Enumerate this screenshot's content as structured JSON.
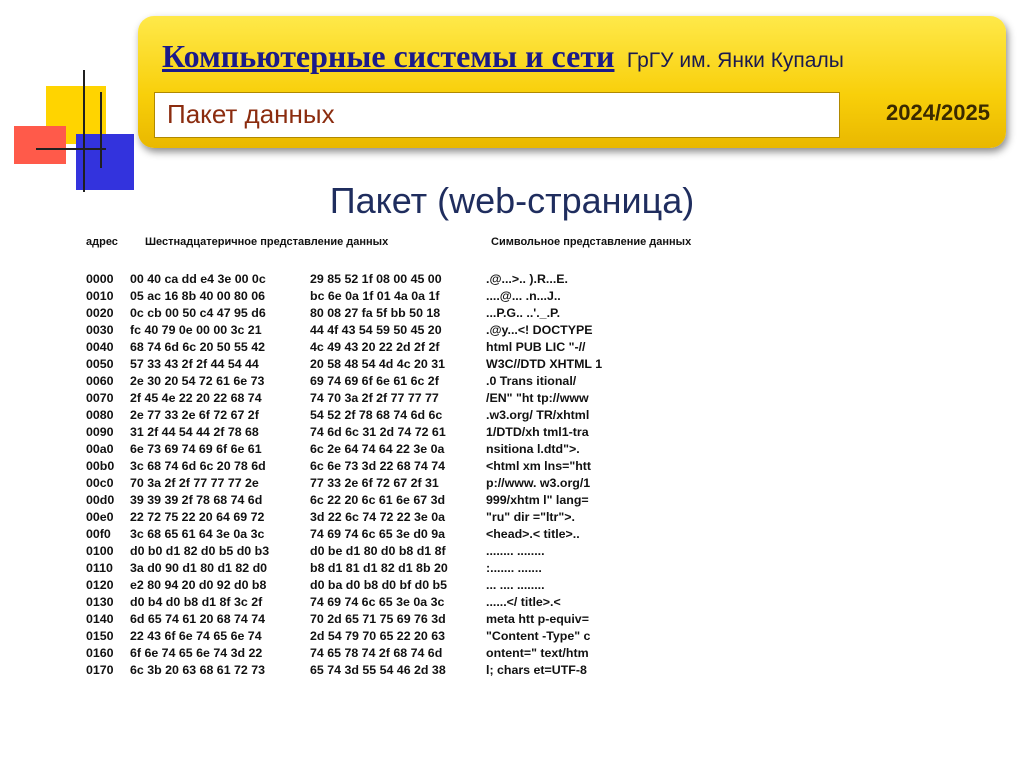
{
  "header": {
    "course": "Компьютерные системы и сети",
    "university": "ГрГУ им. Янки Купалы",
    "subtitle": "Пакет данных",
    "year": "2024/2025"
  },
  "slide_title": "Пакет (web-страница)",
  "columns": {
    "address": "адрес",
    "hex": "Шестнадцатеричное представление данных",
    "chars": "Символьное представление данных"
  },
  "rows": [
    {
      "addr": "0000",
      "hex1": "00 40 ca dd e4 3e 00 0c",
      "hex2": "29 85 52 1f 08 00 45 00",
      "chars": ".@...>.. ).R...E."
    },
    {
      "addr": "0010",
      "hex1": "05 ac 16 8b 40 00 80 06",
      "hex2": "bc 6e 0a 1f 01 4a 0a 1f",
      "chars": "....@... .n...J.."
    },
    {
      "addr": "0020",
      "hex1": "0c cb 00 50 c4 47 95 d6",
      "hex2": "80 08 27 fa 5f bb 50 18",
      "chars": "...P.G.. ..'._.P."
    },
    {
      "addr": "0030",
      "hex1": "fc 40 79 0e 00 00 3c 21",
      "hex2": "44 4f 43 54 59 50 45 20",
      "chars": ".@y...<! DOCTYPE"
    },
    {
      "addr": "0040",
      "hex1": "68 74 6d 6c 20 50 55 42",
      "hex2": "4c 49 43 20 22 2d 2f 2f",
      "chars": "html PUB LIC \"-//"
    },
    {
      "addr": "0050",
      "hex1": "57 33 43 2f 2f 44 54 44",
      "hex2": "20 58 48 54 4d 4c 20 31",
      "chars": "W3C//DTD  XHTML 1"
    },
    {
      "addr": "0060",
      "hex1": "2e 30 20 54 72 61 6e 73",
      "hex2": "69 74 69 6f 6e 61 6c 2f",
      "chars": ".0 Trans itional/"
    },
    {
      "addr": "0070",
      "hex1": "2f 45 4e 22 20 22 68 74",
      "hex2": "74 70 3a 2f 2f 77 77 77",
      "chars": "/EN\" \"ht tp://www"
    },
    {
      "addr": "0080",
      "hex1": "2e 77 33 2e 6f 72 67 2f",
      "hex2": "54 52 2f 78 68 74 6d 6c",
      "chars": ".w3.org/ TR/xhtml"
    },
    {
      "addr": "0090",
      "hex1": "31 2f 44 54 44 2f 78 68",
      "hex2": "74 6d 6c 31 2d 74 72 61",
      "chars": "1/DTD/xh tml1-tra"
    },
    {
      "addr": "00a0",
      "hex1": "6e 73 69 74 69 6f 6e 61",
      "hex2": "6c 2e 64 74 64 22 3e 0a",
      "chars": "nsitiona l.dtd\">."
    },
    {
      "addr": "00b0",
      "hex1": "3c 68 74 6d 6c 20 78 6d",
      "hex2": "6c 6e 73 3d 22 68 74 74",
      "chars": "<html xm lns=\"htt"
    },
    {
      "addr": "00c0",
      "hex1": "70 3a 2f 2f 77 77 77 2e",
      "hex2": "77 33 2e 6f 72 67 2f 31",
      "chars": "p://www. w3.org/1"
    },
    {
      "addr": "00d0",
      "hex1": "39 39 39 2f 78 68 74 6d",
      "hex2": "6c 22 20 6c 61 6e 67 3d",
      "chars": "999/xhtm l\" lang="
    },
    {
      "addr": "00e0",
      "hex1": "22 72 75 22 20 64 69 72",
      "hex2": "3d 22 6c 74 72 22 3e 0a",
      "chars": "\"ru\" dir =\"ltr\">."
    },
    {
      "addr": "00f0",
      "hex1": "3c 68 65 61 64 3e 0a 3c",
      "hex2": "74 69 74 6c 65 3e d0 9a",
      "chars": "<head>.< title>.."
    },
    {
      "addr": "0100",
      "hex1": "d0 b0 d1 82 d0 b5 d0 b3",
      "hex2": "d0 be d1 80 d0 b8 d1 8f",
      "chars": "........ ........"
    },
    {
      "addr": "0110",
      "hex1": "3a d0 90 d1 80 d1 82 d0",
      "hex2": "b8 d1 81 d1 82 d1 8b 20",
      "chars": ":....... ......."
    },
    {
      "addr": "0120",
      "hex1": "e2 80 94 20 d0 92 d0 b8",
      "hex2": "d0 ba d0 b8 d0 bf d0 b5",
      "chars": "... .... ........"
    },
    {
      "addr": "0130",
      "hex1": "d0 b4 d0 b8 d1 8f 3c 2f",
      "hex2": "74 69 74 6c 65 3e 0a 3c",
      "chars": "......</ title>.<"
    },
    {
      "addr": "0140",
      "hex1": "6d 65 74 61 20 68 74 74",
      "hex2": "70 2d 65 71 75 69 76 3d",
      "chars": "meta htt p-equiv="
    },
    {
      "addr": "0150",
      "hex1": "22 43 6f 6e 74 65 6e 74",
      "hex2": "2d 54 79 70 65 22 20 63",
      "chars": "\"Content -Type\" c"
    },
    {
      "addr": "0160",
      "hex1": "6f 6e 74 65 6e 74 3d 22",
      "hex2": "74 65 78 74 2f 68 74 6d",
      "chars": "ontent=\" text/htm"
    },
    {
      "addr": "0170",
      "hex1": "6c 3b 20 63 68 61 72 73",
      "hex2": "65 74 3d 55 54 46 2d 38",
      "chars": "l; chars et=UTF-8"
    }
  ]
}
